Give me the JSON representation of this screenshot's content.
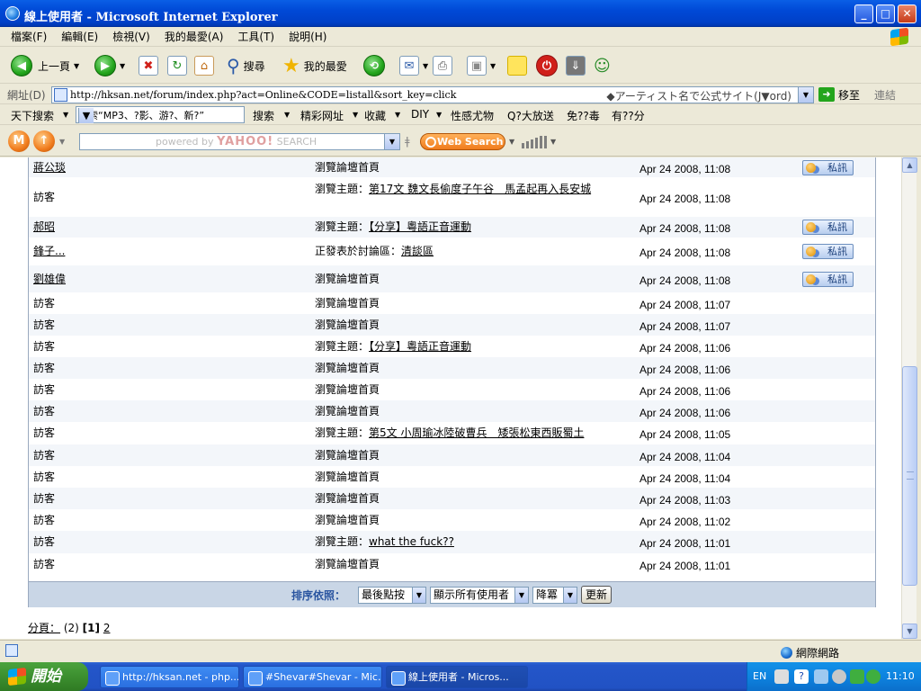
{
  "window": {
    "title": "線上使用者 - Microsoft Internet Explorer",
    "minimize": "_",
    "maximize": "□",
    "close": "✕"
  },
  "menu": [
    "檔案(F)",
    "編輯(E)",
    "檢視(V)",
    "我的最愛(A)",
    "工具(T)",
    "說明(H)"
  ],
  "toolbar": {
    "back": "上一頁",
    "search": "搜尋",
    "favorites": "我的最愛"
  },
  "address": {
    "label": "網址(D)",
    "url": "http://hksan.net/forum/index.php?act=Online&CODE=listall&sort_key=click",
    "hint": "◆アーティスト名で公式サイト(J▼ord)",
    "go": "移至",
    "links": "連結"
  },
  "custom_toolbar": {
    "items": [
      "天下搜索",
      "搜索“MP3、?影、游?、新?”",
      "搜索",
      "精彩网址",
      "收藏",
      "DIY",
      "性感尤物",
      "Q?大放送",
      "免??毒",
      "有??分"
    ]
  },
  "yahoo": {
    "placeholder_small": "powered by",
    "placeholder_brand": "YAHOO!",
    "placeholder_tail": "SEARCH",
    "web_search": "Web Search"
  },
  "rows": [
    {
      "name": "蔣公琰",
      "name_link": true,
      "action": "瀏覽論壇首頁",
      "topic": "",
      "time": "Apr 24 2008, 11:08",
      "pm": true
    },
    {
      "name": "訪客",
      "name_link": false,
      "action": "瀏覽主題：",
      "topic": "第17文 魏文長偷度子午谷　馬孟起再入長安城",
      "time": "Apr 24 2008, 11:08",
      "pm": false
    },
    {
      "name": "郝昭",
      "name_link": true,
      "action": "瀏覽主題：",
      "topic": "【分享】粵語正音運動",
      "time": "Apr 24 2008, 11:08",
      "pm": true
    },
    {
      "name": "鋒子...",
      "name_link": true,
      "action": "正發表於討論區：",
      "topic": "清談區",
      "time": "Apr 24 2008, 11:08",
      "pm": true
    },
    {
      "name": "劉雄偉",
      "name_link": true,
      "action": "瀏覽論壇首頁",
      "topic": "",
      "time": "Apr 24 2008, 11:08",
      "pm": true
    },
    {
      "name": "訪客",
      "name_link": false,
      "action": "瀏覽論壇首頁",
      "topic": "",
      "time": "Apr 24 2008, 11:07",
      "pm": false
    },
    {
      "name": "訪客",
      "name_link": false,
      "action": "瀏覽論壇首頁",
      "topic": "",
      "time": "Apr 24 2008, 11:07",
      "pm": false
    },
    {
      "name": "訪客",
      "name_link": false,
      "action": "瀏覽主題：",
      "topic": "【分享】粵語正音運動",
      "time": "Apr 24 2008, 11:06",
      "pm": false
    },
    {
      "name": "訪客",
      "name_link": false,
      "action": "瀏覽論壇首頁",
      "topic": "",
      "time": "Apr 24 2008, 11:06",
      "pm": false
    },
    {
      "name": "訪客",
      "name_link": false,
      "action": "瀏覽論壇首頁",
      "topic": "",
      "time": "Apr 24 2008, 11:06",
      "pm": false
    },
    {
      "name": "訪客",
      "name_link": false,
      "action": "瀏覽論壇首頁",
      "topic": "",
      "time": "Apr 24 2008, 11:06",
      "pm": false
    },
    {
      "name": "訪客",
      "name_link": false,
      "action": "瀏覽主題：",
      "topic": "第5文 小周瑜冰陸破曹兵　矮張松東西販蜀土",
      "time": "Apr 24 2008, 11:05",
      "pm": false
    },
    {
      "name": "訪客",
      "name_link": false,
      "action": "瀏覽論壇首頁",
      "topic": "",
      "time": "Apr 24 2008, 11:04",
      "pm": false
    },
    {
      "name": "訪客",
      "name_link": false,
      "action": "瀏覽論壇首頁",
      "topic": "",
      "time": "Apr 24 2008, 11:04",
      "pm": false
    },
    {
      "name": "訪客",
      "name_link": false,
      "action": "瀏覽論壇首頁",
      "topic": "",
      "time": "Apr 24 2008, 11:03",
      "pm": false
    },
    {
      "name": "訪客",
      "name_link": false,
      "action": "瀏覽論壇首頁",
      "topic": "",
      "time": "Apr 24 2008, 11:02",
      "pm": false
    },
    {
      "name": "訪客",
      "name_link": false,
      "action": "瀏覽主題：",
      "topic": "what the fuck??",
      "time": "Apr 24 2008, 11:01",
      "pm": false
    },
    {
      "name": "訪客",
      "name_link": false,
      "action": "瀏覽論壇首頁",
      "topic": "",
      "time": "Apr 24 2008, 11:01",
      "pm": false
    }
  ],
  "pm_label": "私訊",
  "sort": {
    "label": "排序依照：",
    "sort_key": "最後點按",
    "filter": "顯示所有使用者",
    "order": "降冪",
    "refresh": "更新"
  },
  "pager": {
    "label": "分頁：",
    "total": "(2)",
    "current": "[1]",
    "next": "2"
  },
  "status": {
    "zone": "網際網路"
  },
  "taskbar": {
    "start": "開始",
    "tasks": [
      "http://hksan.net - php...",
      "#Shevar#Shevar - Mic...",
      "線上使用者 - Micros..."
    ],
    "lang": "EN",
    "clock": "11:10"
  }
}
